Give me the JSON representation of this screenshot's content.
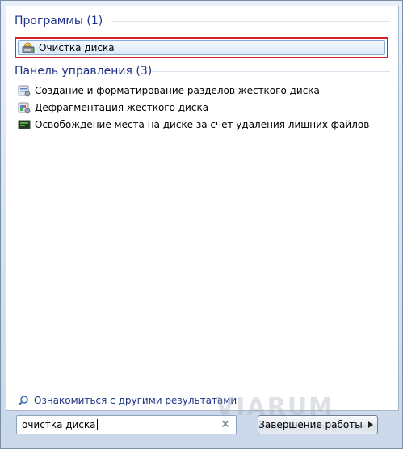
{
  "programs": {
    "header": "Программы (1)",
    "items": [
      {
        "label": "Очистка диска",
        "icon": "disk-cleanup-icon"
      }
    ]
  },
  "control_panel": {
    "header": "Панель управления (3)",
    "items": [
      {
        "label": "Создание и форматирование разделов жесткого диска",
        "icon": "disk-management-icon"
      },
      {
        "label": "Дефрагментация жесткого диска",
        "icon": "defrag-icon"
      },
      {
        "label": "Освобождение места на диске за счет удаления лишних файлов",
        "icon": "free-space-icon"
      }
    ]
  },
  "more_results": {
    "label": "Ознакомиться с другими результатами",
    "icon": "search-icon"
  },
  "search": {
    "value": "очистка диска",
    "clear_icon": "clear-icon"
  },
  "shutdown": {
    "label": "Завершение работы",
    "arrow_icon": "arrow-right-icon"
  },
  "watermark": "VIARUM",
  "colors": {
    "header_text": "#1e3287",
    "highlight_border": "#d3222a",
    "selection": "#dae9f8"
  }
}
